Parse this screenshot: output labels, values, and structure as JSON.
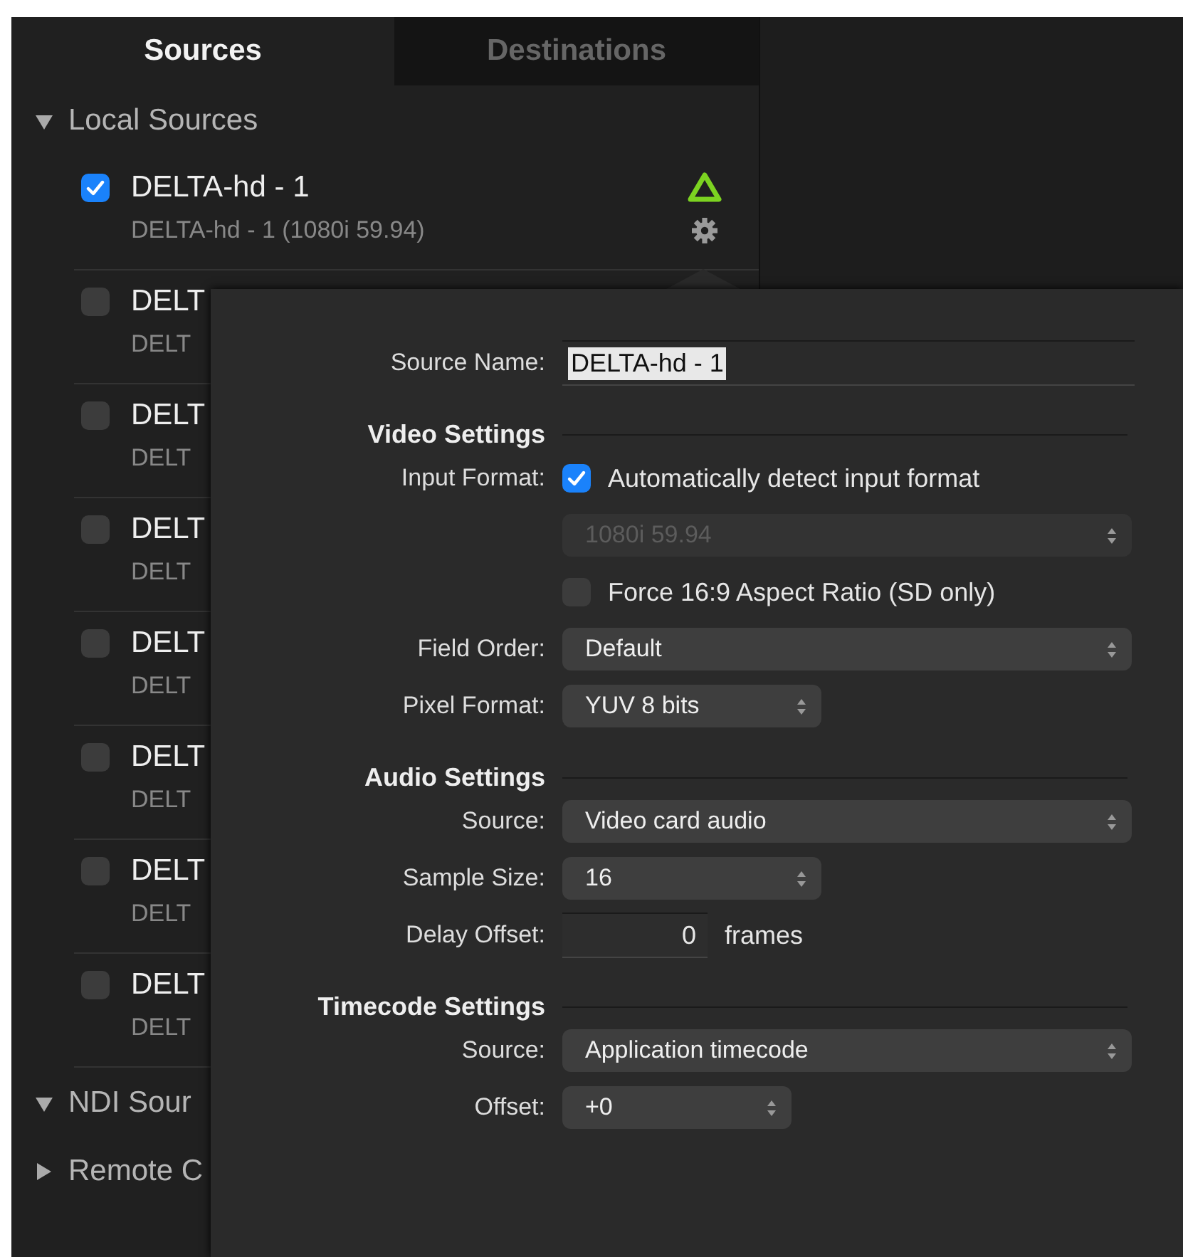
{
  "tabs": [
    {
      "label": "Sources",
      "selected": true
    },
    {
      "label": "Destinations",
      "selected": false
    }
  ],
  "groups": [
    {
      "label": "Local Sources",
      "expanded": true,
      "sources": [
        {
          "name": "DELTA-hd - 1",
          "detail": "DELTA-hd - 1 (1080i 59.94)",
          "checked": true,
          "kind": "with-status"
        },
        {
          "name": "DELT",
          "detail": "DELT",
          "checked": false,
          "kind": "plain"
        },
        {
          "name": "DELT",
          "detail": "DELT",
          "checked": false,
          "kind": "plain"
        },
        {
          "name": "DELT",
          "detail": "DELT",
          "checked": false,
          "kind": "plain"
        },
        {
          "name": "DELT",
          "detail": "DELT",
          "checked": false,
          "kind": "plain"
        },
        {
          "name": "DELT",
          "detail": "DELT",
          "checked": false,
          "kind": "plain"
        },
        {
          "name": "DELT",
          "detail": "DELT",
          "checked": false,
          "kind": "plain"
        },
        {
          "name": "DELT",
          "detail": "DELT",
          "checked": false,
          "kind": "plain"
        }
      ]
    },
    {
      "label": "NDI Sour",
      "expanded": true
    },
    {
      "label": "Remote C",
      "expanded": false
    }
  ],
  "popover": {
    "source_name": {
      "label": "Source Name:",
      "value": "DELTA-hd - 1"
    },
    "sections": [
      {
        "title": "Video Settings",
        "rows": [
          {
            "kind": "checkbox",
            "label": "Input Format:",
            "text": "Automatically detect input format",
            "checked": true
          },
          {
            "kind": "select",
            "value": "1080i 59.94",
            "disabled": true
          },
          {
            "kind": "checkbox",
            "text": "Force 16:9 Aspect Ratio (SD only)",
            "checked": false
          },
          {
            "kind": "select",
            "label": "Field Order:",
            "value": "Default",
            "disabled": false
          },
          {
            "kind": "compact-select",
            "label": "Pixel Format:",
            "value": "YUV 8 bits",
            "disabled": false
          }
        ]
      },
      {
        "title": "Audio Settings",
        "rows": [
          {
            "kind": "select",
            "label": "Source:",
            "value": "Video card audio",
            "disabled": false
          },
          {
            "kind": "compact-select",
            "label": "Sample Size:",
            "value": "16",
            "disabled": false
          },
          {
            "kind": "number",
            "label": "Delay Offset:",
            "value": "0",
            "unit": "frames"
          }
        ]
      },
      {
        "title": "Timecode Settings",
        "rows": [
          {
            "kind": "select",
            "label": "Source:",
            "value": "Application timecode",
            "disabled": false
          },
          {
            "kind": "short-select",
            "label": "Offset:",
            "value": "+0",
            "disabled": false
          }
        ]
      }
    ]
  }
}
